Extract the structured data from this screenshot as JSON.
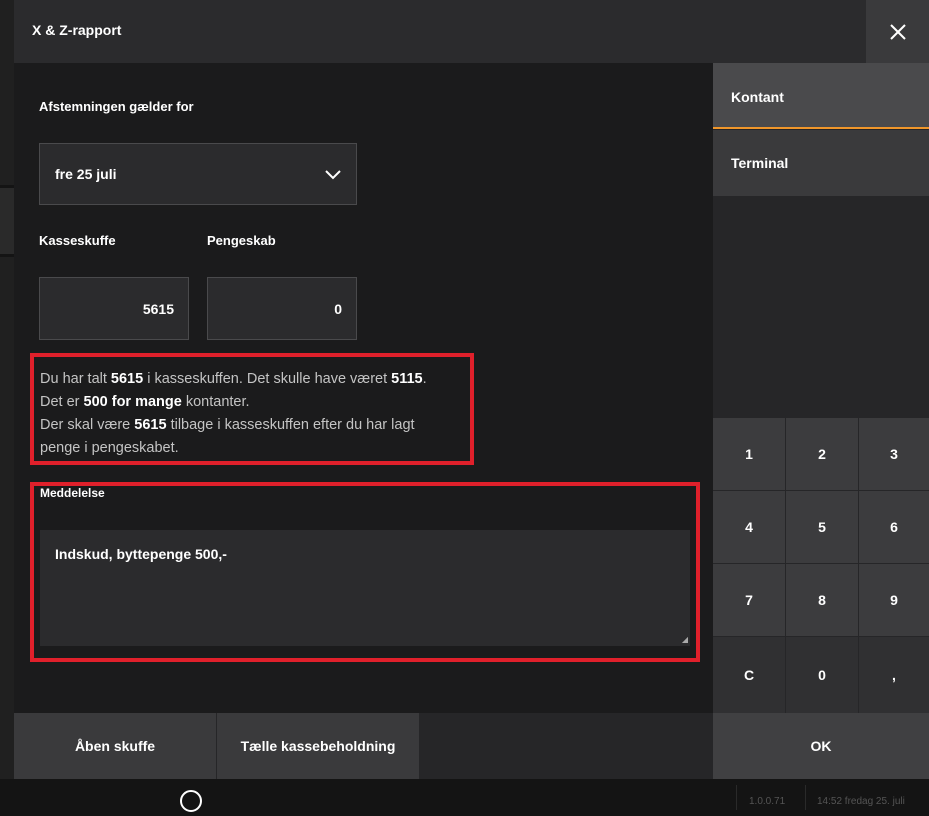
{
  "window": {
    "title": "X & Z-rapport"
  },
  "form": {
    "period_label": "Afstemningen gælder for",
    "period_value": "fre 25 juli",
    "drawer_label": "Kasseskuffe",
    "drawer_value": "5615",
    "safe_label": "Pengeskab",
    "safe_value": "0"
  },
  "info": {
    "l1a": "Du har talt ",
    "l1b": "5615",
    "l1c": " i kasseskuffen. Det skulle have været ",
    "l1d": "5115",
    "l1e": ".",
    "l2a": "Det er ",
    "l2b": "500 for mange",
    "l2c": " kontanter.",
    "l3a": "Der skal være ",
    "l3b": "5615",
    "l3c": " tilbage i kasseskuffen efter du har lagt",
    "l4": "penge i pengeskabet."
  },
  "message": {
    "label": "Meddelelse",
    "value": "Indskud, byttepenge 500,-"
  },
  "tabs": {
    "cash": "Kontant",
    "terminal": "Terminal"
  },
  "keypad": {
    "k1": "1",
    "k2": "2",
    "k3": "3",
    "k4": "4",
    "k5": "5",
    "k6": "6",
    "k7": "7",
    "k8": "8",
    "k9": "9",
    "kc": "C",
    "k0": "0",
    "kcomma": ","
  },
  "bottom": {
    "open_drawer": "Åben skuffe",
    "count_cash": "Tælle kassebeholdning",
    "ok": "OK"
  },
  "footer": {
    "version": "1.0.0.71",
    "datetime": "14:52 fredag 25. juli"
  },
  "colors": {
    "accent": "#f0962a",
    "highlight": "#e0202b"
  }
}
